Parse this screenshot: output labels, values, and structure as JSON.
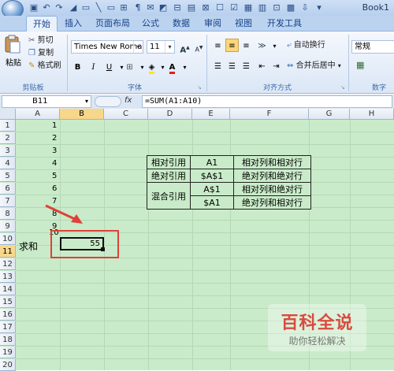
{
  "window": {
    "title": "Book1"
  },
  "tabs": [
    "开始",
    "插入",
    "页面布局",
    "公式",
    "数据",
    "审阅",
    "视图",
    "开发工具"
  ],
  "ribbon": {
    "clipboard": {
      "paste": "粘贴",
      "cut": "剪切",
      "copy": "复制",
      "format_painter": "格式刷",
      "label": "剪贴板"
    },
    "font": {
      "family": "Times New Roman",
      "size": "11",
      "bold": "B",
      "italic": "I",
      "underline": "U",
      "grow": "A",
      "shrink": "A",
      "font_color": "A",
      "label": "字体"
    },
    "alignment": {
      "wrap_text": "自动换行",
      "merge_center": "合并后居中",
      "label": "对齐方式"
    },
    "number": {
      "format": "常规",
      "label": "数字"
    }
  },
  "formula_bar": {
    "name_box": "B11",
    "fx": "fx",
    "formula": "=SUM(A1:A10)"
  },
  "columns": [
    "A",
    "B",
    "C",
    "D",
    "E",
    "F",
    "G",
    "H"
  ],
  "rows": [
    "1",
    "2",
    "3",
    "4",
    "5",
    "6",
    "7",
    "8",
    "9",
    "10",
    "11",
    "12",
    "13",
    "14",
    "15",
    "16",
    "17",
    "18",
    "19",
    "20"
  ],
  "cells": {
    "a_values": [
      "1",
      "2",
      "3",
      "4",
      "5",
      "6",
      "7",
      "8",
      "9",
      "10"
    ],
    "sum_label": "求和",
    "sum_value": "55"
  },
  "ref_table": {
    "r1": [
      "相对引用",
      "A1",
      "相对列和相对行"
    ],
    "r2": [
      "绝对引用",
      "$A$1",
      "绝对列和绝对行"
    ],
    "r3": [
      "混合引用",
      "A$1",
      "相对列和绝对行"
    ],
    "r4": [
      "$A1",
      "绝对列和相对行"
    ]
  },
  "watermark": {
    "title": "百科全说",
    "subtitle": "助你轻松解决"
  },
  "colors": {
    "sheet_bg": "#c9ebc9",
    "annotation_red": "#e0403a",
    "selected_header": "#f8d78b"
  }
}
